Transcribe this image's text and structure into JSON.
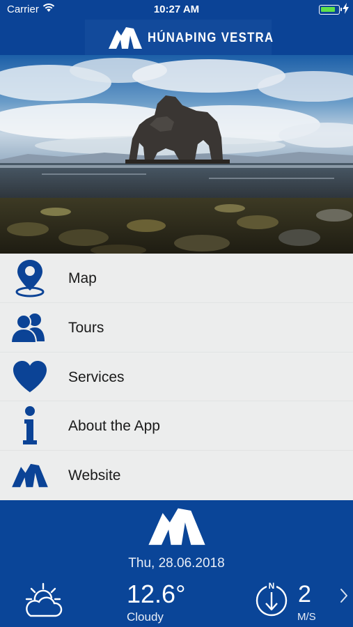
{
  "status_bar": {
    "carrier": "Carrier",
    "time": "10:27 AM",
    "battery_level": 0.85
  },
  "header": {
    "brand_text": "HÚNAÞING VESTRA"
  },
  "menu": {
    "items": [
      {
        "label": "Map",
        "icon": "map-pin-icon"
      },
      {
        "label": "Tours",
        "icon": "people-icon"
      },
      {
        "label": "Services",
        "icon": "heart-icon"
      },
      {
        "label": "About the App",
        "icon": "info-icon"
      },
      {
        "label": "Website",
        "icon": "brand-mountain-icon"
      }
    ]
  },
  "weather": {
    "date": "Thu, 28.06.2018",
    "temperature": "12.6°",
    "condition": "Cloudy",
    "wind_speed": "2",
    "wind_unit": "M/S",
    "wind_compass_label": "N"
  },
  "colors": {
    "brand_blue": "#0a4598",
    "menu_bg": "#eceded",
    "icon_blue": "#0b4396"
  }
}
